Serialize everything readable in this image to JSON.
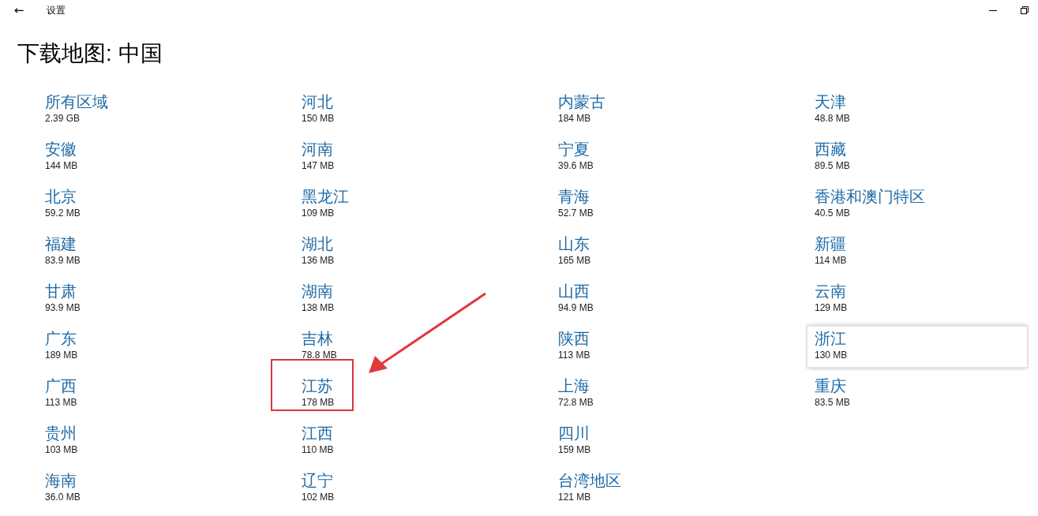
{
  "window": {
    "title": "设置",
    "back": "←"
  },
  "heading": "下载地图: 中国",
  "regions": [
    {
      "name": "所有区域",
      "size": "2.39 GB",
      "focused": false,
      "annotated": false
    },
    {
      "name": "安徽",
      "size": "144 MB",
      "focused": false,
      "annotated": false
    },
    {
      "name": "北京",
      "size": "59.2 MB",
      "focused": false,
      "annotated": false
    },
    {
      "name": "福建",
      "size": "83.9 MB",
      "focused": false,
      "annotated": false
    },
    {
      "name": "甘肃",
      "size": "93.9 MB",
      "focused": false,
      "annotated": false
    },
    {
      "name": "广东",
      "size": "189 MB",
      "focused": false,
      "annotated": false
    },
    {
      "name": "广西",
      "size": "113 MB",
      "focused": false,
      "annotated": false
    },
    {
      "name": "贵州",
      "size": "103 MB",
      "focused": false,
      "annotated": false
    },
    {
      "name": "海南",
      "size": "36.0 MB",
      "focused": false,
      "annotated": false
    },
    {
      "name": "河北",
      "size": "150 MB",
      "focused": false,
      "annotated": false
    },
    {
      "name": "河南",
      "size": "147 MB",
      "focused": false,
      "annotated": false
    },
    {
      "name": "黑龙江",
      "size": "109 MB",
      "focused": false,
      "annotated": false
    },
    {
      "name": "湖北",
      "size": "136 MB",
      "focused": false,
      "annotated": false
    },
    {
      "name": "湖南",
      "size": "138 MB",
      "focused": false,
      "annotated": false
    },
    {
      "name": "吉林",
      "size": "78.8 MB",
      "focused": false,
      "annotated": false
    },
    {
      "name": "江苏",
      "size": "178 MB",
      "focused": false,
      "annotated": true
    },
    {
      "name": "江西",
      "size": "110 MB",
      "focused": false,
      "annotated": false
    },
    {
      "name": "辽宁",
      "size": "102 MB",
      "focused": false,
      "annotated": false
    },
    {
      "name": "内蒙古",
      "size": "184 MB",
      "focused": false,
      "annotated": false
    },
    {
      "name": "宁夏",
      "size": "39.6 MB",
      "focused": false,
      "annotated": false
    },
    {
      "name": "青海",
      "size": "52.7 MB",
      "focused": false,
      "annotated": false
    },
    {
      "name": "山东",
      "size": "165 MB",
      "focused": false,
      "annotated": false
    },
    {
      "name": "山西",
      "size": "94.9 MB",
      "focused": false,
      "annotated": false
    },
    {
      "name": "陕西",
      "size": "113 MB",
      "focused": false,
      "annotated": false
    },
    {
      "name": "上海",
      "size": "72.8 MB",
      "focused": false,
      "annotated": false
    },
    {
      "name": "四川",
      "size": "159 MB",
      "focused": false,
      "annotated": false
    },
    {
      "name": "台湾地区",
      "size": "121 MB",
      "focused": false,
      "annotated": false
    },
    {
      "name": "天津",
      "size": "48.8 MB",
      "focused": false,
      "annotated": false
    },
    {
      "name": "西藏",
      "size": "89.5 MB",
      "focused": false,
      "annotated": false
    },
    {
      "name": "香港和澳门特区",
      "size": "40.5 MB",
      "focused": false,
      "annotated": false
    },
    {
      "name": "新疆",
      "size": "114 MB",
      "focused": false,
      "annotated": false
    },
    {
      "name": "云南",
      "size": "129 MB",
      "focused": false,
      "annotated": false
    },
    {
      "name": "浙江",
      "size": "130 MB",
      "focused": true,
      "annotated": false
    },
    {
      "name": "重庆",
      "size": "83.5 MB",
      "focused": false,
      "annotated": false
    }
  ]
}
